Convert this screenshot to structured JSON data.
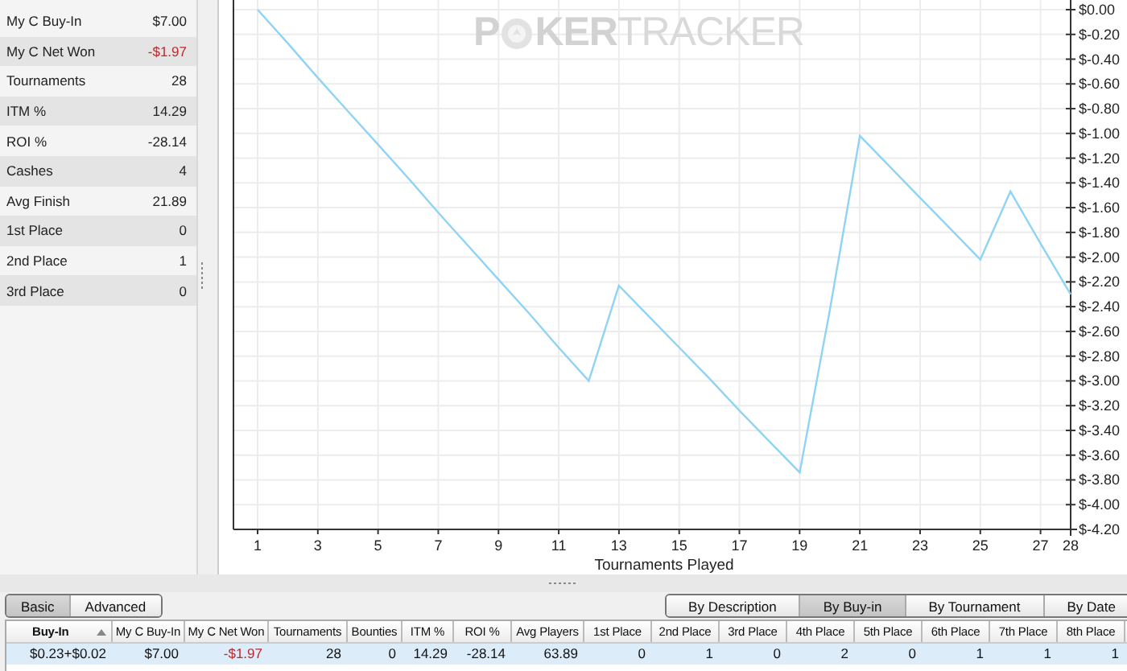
{
  "stats": [
    {
      "label": "My C Buy-In",
      "value": "$7.00",
      "negative": false
    },
    {
      "label": "My C Net Won",
      "value": "-$1.97",
      "negative": true
    },
    {
      "label": "Tournaments",
      "value": "28",
      "negative": false
    },
    {
      "label": "ITM %",
      "value": "14.29",
      "negative": false
    },
    {
      "label": "ROI %",
      "value": "-28.14",
      "negative": false
    },
    {
      "label": "Cashes",
      "value": "4",
      "negative": false
    },
    {
      "label": "Avg Finish",
      "value": "21.89",
      "negative": false
    },
    {
      "label": "1st Place",
      "value": "0",
      "negative": false
    },
    {
      "label": "2nd Place",
      "value": "1",
      "negative": false
    },
    {
      "label": "3rd Place",
      "value": "0",
      "negative": false
    }
  ],
  "chart": {
    "watermark": {
      "bold_start": "P",
      "bold_end": "KER",
      "light": "TRACKER"
    },
    "chart_data": {
      "type": "line",
      "xlabel": "Tournaments Played",
      "x": [
        1,
        2,
        3,
        4,
        5,
        6,
        7,
        8,
        9,
        10,
        11,
        12,
        13,
        14,
        15,
        16,
        17,
        18,
        19,
        20,
        21,
        22,
        23,
        24,
        25,
        26,
        27,
        28
      ],
      "grid": true,
      "series": [
        {
          "color": "#8fd3f5",
          "values": [
            0,
            -0.27,
            -0.55,
            -0.82,
            -1.09,
            -1.36,
            -1.64,
            -1.91,
            -2.18,
            -2.45,
            -2.73,
            -3.0,
            -2.23,
            -2.48,
            -2.73,
            -2.98,
            -3.24,
            -3.49,
            -3.74,
            -2.43,
            -1.02,
            -1.27,
            -1.52,
            -1.77,
            -2.02,
            -1.47,
            -1.89,
            -2.3
          ]
        }
      ],
      "xlim": [
        1,
        28
      ],
      "ylim": [
        -4.2,
        0
      ],
      "xticks": [
        1,
        3,
        5,
        7,
        9,
        11,
        13,
        15,
        17,
        19,
        21,
        23,
        25,
        27,
        28
      ],
      "yticks": [
        {
          "value": 0,
          "label": "$0.00"
        },
        {
          "value": -0.2,
          "label": "$-0.20"
        },
        {
          "value": -0.4,
          "label": "$-0.40"
        },
        {
          "value": -0.6,
          "label": "$-0.60"
        },
        {
          "value": -0.8,
          "label": "$-0.80"
        },
        {
          "value": -1.0,
          "label": "$-1.00"
        },
        {
          "value": -1.2,
          "label": "$-1.20"
        },
        {
          "value": -1.4,
          "label": "$-1.40"
        },
        {
          "value": -1.6,
          "label": "$-1.60"
        },
        {
          "value": -1.8,
          "label": "$-1.80"
        },
        {
          "value": -2.0,
          "label": "$-2.00"
        },
        {
          "value": -2.2,
          "label": "$-2.20"
        },
        {
          "value": -2.4,
          "label": "$-2.40"
        },
        {
          "value": -2.6,
          "label": "$-2.60"
        },
        {
          "value": -2.8,
          "label": "$-2.80"
        },
        {
          "value": -3.0,
          "label": "$-3.00"
        },
        {
          "value": -3.2,
          "label": "$-3.20"
        },
        {
          "value": -3.4,
          "label": "$-3.40"
        },
        {
          "value": -3.6,
          "label": "$-3.60"
        },
        {
          "value": -3.8,
          "label": "$-3.80"
        },
        {
          "value": -4.0,
          "label": "$-4.00"
        },
        {
          "value": -4.2,
          "label": "$-4.20"
        }
      ]
    }
  },
  "view_buttons": [
    {
      "label": "Basic",
      "selected": true
    },
    {
      "label": "Advanced",
      "selected": false
    }
  ],
  "group_buttons": [
    {
      "label": "By Description",
      "selected": false
    },
    {
      "label": "By Buy-in",
      "selected": true
    },
    {
      "label": "By Tournament",
      "selected": false
    },
    {
      "label": "By Date",
      "selected": false
    }
  ],
  "table": {
    "columns": [
      {
        "label": "Buy-In",
        "sorted": true
      },
      {
        "label": "My C Buy-In",
        "sorted": false
      },
      {
        "label": "My C Net Won",
        "sorted": false
      },
      {
        "label": "Tournaments",
        "sorted": false
      },
      {
        "label": "Bounties",
        "sorted": false
      },
      {
        "label": "ITM %",
        "sorted": false
      },
      {
        "label": "ROI %",
        "sorted": false
      },
      {
        "label": "Avg Players",
        "sorted": false
      },
      {
        "label": "1st Place",
        "sorted": false
      },
      {
        "label": "2nd Place",
        "sorted": false
      },
      {
        "label": "3rd Place",
        "sorted": false
      },
      {
        "label": "4th Place",
        "sorted": false
      },
      {
        "label": "5th Place",
        "sorted": false
      },
      {
        "label": "6th Place",
        "sorted": false
      },
      {
        "label": "7th Place",
        "sorted": false
      },
      {
        "label": "8th Place",
        "sorted": false
      }
    ],
    "rows": [
      {
        "selected": true,
        "cells": [
          {
            "text": "$0.23+$0.02",
            "negative": false
          },
          {
            "text": "$7.00",
            "negative": false
          },
          {
            "text": "-$1.97",
            "negative": true
          },
          {
            "text": "28",
            "negative": false
          },
          {
            "text": "0",
            "negative": false
          },
          {
            "text": "14.29",
            "negative": false
          },
          {
            "text": "-28.14",
            "negative": false
          },
          {
            "text": "63.89",
            "negative": false
          },
          {
            "text": "0",
            "negative": false
          },
          {
            "text": "1",
            "negative": false
          },
          {
            "text": "0",
            "negative": false
          },
          {
            "text": "2",
            "negative": false
          },
          {
            "text": "0",
            "negative": false
          },
          {
            "text": "1",
            "negative": false
          },
          {
            "text": "1",
            "negative": false
          },
          {
            "text": "1",
            "negative": false
          }
        ]
      }
    ]
  }
}
